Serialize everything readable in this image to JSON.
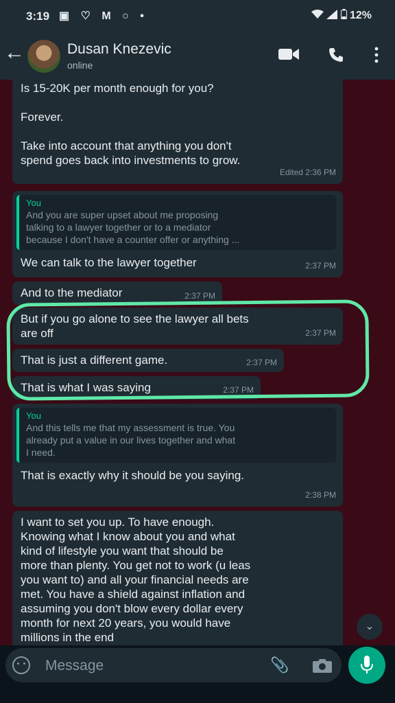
{
  "status_bar": {
    "time": "3:19",
    "icons": "▣ ♡ M ○ •",
    "battery": "12%"
  },
  "header": {
    "contact_name": "Dusan Knezevic",
    "status": "online",
    "icons": [
      "back-arrow-icon",
      "avatar",
      "video-call-icon",
      "phone-icon",
      "more-vert-icon"
    ]
  },
  "messages": [
    {
      "text": "Is 15-20K per month enough for you?\n\nForever.\n\nTake into account that anything you don't\nspend goes back into investments to grow.",
      "meta": "Edited 2:36 PM"
    },
    {
      "quote_name": "You",
      "quote_text": "And you are super upset about me proposing\ntalking to a lawyer together or to a mediator\nbecause I don't have a counter offer or anything ...",
      "text": "We can talk to the lawyer together",
      "meta": "2:37 PM"
    },
    {
      "text": "And to the mediator",
      "meta": "2:37 PM"
    },
    {
      "text": "But if you go alone to see the lawyer all bets\nare off",
      "meta": "2:37 PM"
    },
    {
      "text": "That is just a different game.",
      "meta": "2:37 PM"
    },
    {
      "text": "That is what I was saying",
      "meta": "2:37 PM"
    },
    {
      "quote_name": "You",
      "quote_text": "And this tells me that my assessment is true. You\nalready put a value in our lives together and what\nI need.",
      "text": "That is exactly why it should be you saying.",
      "meta": "2:38 PM"
    },
    {
      "text": "I want to set you up. To have enough.\nKnowing what I know about you and what\nkind of lifestyle you want that should be\nmore than plenty. You get not to work (u leas\nyou want to) and all your financial needs are\nmet. You have a shield against inflation and\nassuming you don't blow every dollar every\nmonth for next 20 years, you would have\nmillions in the end",
      "meta": ""
    }
  ],
  "input": {
    "placeholder": "Message"
  },
  "colors": {
    "chat_bg": "#3a0a16",
    "bubble": "#1f2c33",
    "accent": "#00a884",
    "highlight": "#5fe8a8"
  }
}
